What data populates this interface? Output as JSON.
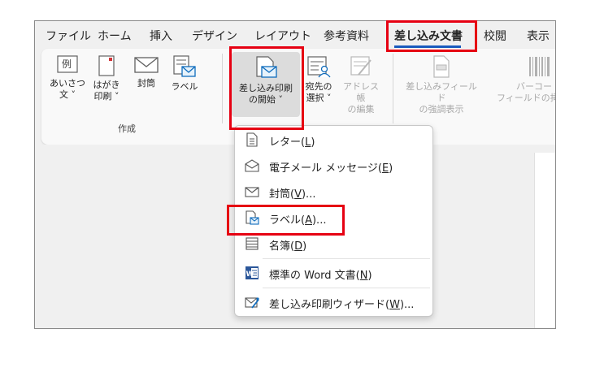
{
  "tabs": [
    "ファイル",
    "ホーム",
    "挿入",
    "デザイン",
    "レイアウト",
    "参考資料",
    "差し込み文書",
    "校閲",
    "表示"
  ],
  "active_tab": "差し込み文書",
  "ribbon": {
    "create_group": {
      "label": "作成",
      "greeting_line1": "あいさつ",
      "greeting_line2": "文 ˅",
      "postcard_line1": "はがき",
      "postcard_line2": "印刷 ˅",
      "envelope": "封筒",
      "label_btn": "ラベル",
      "greeting_icon_char": "例"
    },
    "mailmerge_group": {
      "start_line1": "差し込み印刷",
      "start_line2": "の開始 ˅",
      "recipients_line1": "宛先の",
      "recipients_line2": "選択 ˅",
      "edit_list_line1": "アドレス帳",
      "edit_list_line2": "の編集"
    },
    "fields_group": {
      "highlight_line1": "差し込みフィールド",
      "highlight_line2": "の強調表示",
      "barcode_line1": "バーコー",
      "barcode_line2": "フィールドの挿"
    }
  },
  "menu": {
    "letter": {
      "text": "レター(",
      "key": "L",
      "tail": ")"
    },
    "email": {
      "text": "電子メール メッセージ(",
      "key": "E",
      "tail": ")"
    },
    "envelope": {
      "text": "封筒(",
      "key": "V",
      "tail": ")..."
    },
    "labels": {
      "text": "ラベル(",
      "key": "A",
      "tail": ")..."
    },
    "directory": {
      "text": "名簿(",
      "key": "D",
      "tail": ")"
    },
    "normal": {
      "text": "標準の Word 文書(",
      "key": "N",
      "tail": ")"
    },
    "wizard": {
      "text": "差し込み印刷ウィザード(",
      "key": "W",
      "tail": ")..."
    }
  },
  "colors": {
    "highlight": "#e60012",
    "accent": "#185abd",
    "word_blue": "#2b579a"
  }
}
